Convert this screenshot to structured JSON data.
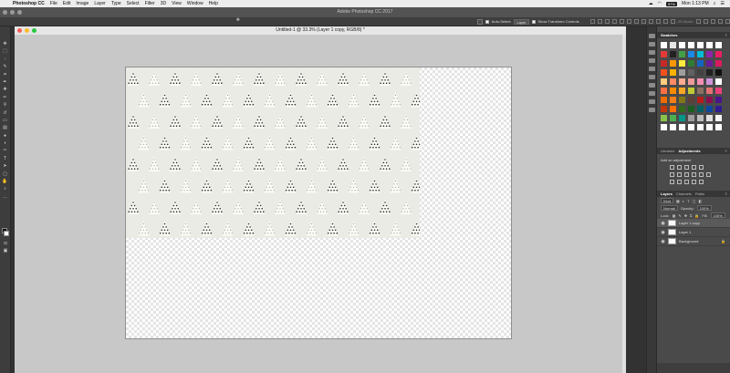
{
  "menubar": {
    "app_name": "Photoshop CC",
    "items": [
      "File",
      "Edit",
      "Image",
      "Layer",
      "Type",
      "Select",
      "Filter",
      "3D",
      "View",
      "Window",
      "Help"
    ],
    "battery": "97%",
    "clock": "Mon 1:13 PM"
  },
  "app": {
    "title": "Adobe Photoshop CC 2017"
  },
  "options": {
    "auto_select_label": "Auto-Select:",
    "auto_select_value": "Layer",
    "transform_label": "Show Transform Controls",
    "mode_3d": "3D Mode:"
  },
  "document": {
    "title": "Untitled-1 @ 33.3% (Layer 1 copy, RGB/8) *"
  },
  "panels": {
    "swatches_tab": "Swatches",
    "libraries_tab": "Libraries",
    "adjustments_tab": "Adjustments",
    "add_adjustment": "Add an adjustment",
    "layers_tab": "Layers",
    "channels_tab": "Channels",
    "paths_tab": "Paths",
    "kind": "Kind",
    "blend_mode": "Normal",
    "opacity_label": "Opacity:",
    "opacity_value": "100%",
    "lock_label": "Lock:",
    "fill_label": "Fill:",
    "fill_value": "100%"
  },
  "layers": [
    {
      "name": "Layer 1 copy",
      "selected": true
    },
    {
      "name": "Layer 1",
      "selected": false
    },
    {
      "name": "Background",
      "selected": false,
      "locked": true
    }
  ],
  "swatch_colors": [
    "#ffffff",
    "#e6e6e6",
    "#ffffff",
    "#ffffff",
    "#ffffff",
    "#ffffff",
    "#ffffff",
    "#e53935",
    "#222222",
    "#43a047",
    "#1e88e5",
    "#00bcd4",
    "#8e24aa",
    "#e91e63",
    "#c62828",
    "#ff9800",
    "#ffeb3b",
    "#2e7d32",
    "#1565c0",
    "#6a1b9a",
    "#d81b60",
    "#f4511e",
    "#ffb300",
    "#9e9e9e",
    "#616161",
    "#424242",
    "#212121",
    "#111111",
    "#ffcc80",
    "#ff8a65",
    "#ffab91",
    "#ef9a9a",
    "#f48fb1",
    "#ce93d8",
    "#ffffff",
    "#ff7043",
    "#fb8c00",
    "#f9a825",
    "#c0ca33",
    "#8d6e63",
    "#e57373",
    "#ec407a",
    "#ef6c00",
    "#f57f17",
    "#827717",
    "#5d4037",
    "#b71c1c",
    "#880e4f",
    "#4a148c",
    "#bf360c",
    "#ff6f00",
    "#33691e",
    "#1b5e20",
    "#006064",
    "#0d47a1",
    "#311b92",
    "#8bc34a",
    "#4caf50",
    "#009688",
    "#9e9e9e",
    "#bdbdbd",
    "#e0e0e0",
    "#f5f5f5",
    "#ffffff",
    "#ffffff",
    "#ffffff",
    "#ffffff",
    "#ffffff",
    "#ffffff",
    "#ffffff"
  ]
}
